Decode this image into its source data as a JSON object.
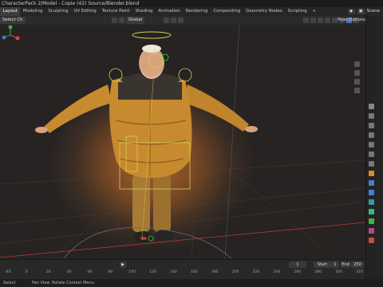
{
  "window": {
    "title": "CharacterPack 2/Model - Copie (42) Source/Blender.blend"
  },
  "workspaces": [
    "Layout",
    "Modeling",
    "Sculpting",
    "UV Editing",
    "Texture Paint",
    "Shading",
    "Animation",
    "Rendering",
    "Compositing",
    "Geometry Nodes",
    "Scripting",
    "+"
  ],
  "active_workspace": "Layout",
  "topright": {
    "scene_label": "Scene"
  },
  "header3d": {
    "mode": "Select Ch",
    "orientation": "Global",
    "pose_options": "Pose Options"
  },
  "timeline": {
    "frame_current": "1",
    "start_label": "Start",
    "start_value": "1",
    "end_label": "End",
    "end_value": "250",
    "ruler_labels": [
      "-40",
      "0",
      "20",
      "40",
      "60",
      "80",
      "100",
      "120",
      "140",
      "160",
      "180",
      "200",
      "220",
      "240",
      "260",
      "280",
      "300",
      "320"
    ]
  },
  "status": {
    "left": "Select",
    "middle": "Pan View",
    "right": "Rotate Context Menu"
  },
  "colors": {
    "accent": "#4772b3",
    "jacket": "#c88a2e",
    "background": "#1d1d1d"
  }
}
